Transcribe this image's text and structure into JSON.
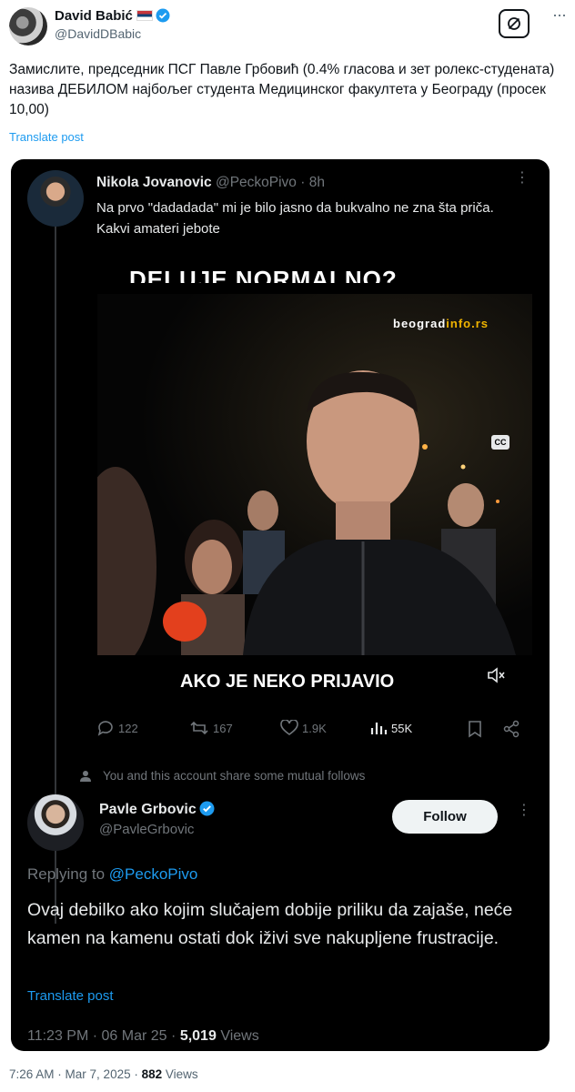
{
  "tweet": {
    "author_name": "David Babić",
    "author_handle": "@DavidDBabic",
    "text": "Замислите, председник ПСГ Павле Грбовић (0.4% гласова и зет ролекс-студената) назива ДЕБИЛОМ најбољег студента Медицинског факултета у Београду (просек 10,00)",
    "translate_label": "Translate post",
    "time": "7:26 AM",
    "date": "Mar 7, 2025",
    "views_count": "882",
    "views_label": "Views"
  },
  "quoted": {
    "author_name": "Nikola Jovanovic",
    "author_handle": "@PeckoPivo",
    "age": "8h",
    "text_line1": "Na prvo \"dadadada\" mi je bilo jasno da bukvalno ne zna šta priča.",
    "text_line2": "Kakvi amateri jebote",
    "video": {
      "caption_top": "DELUJE NORMALNO?",
      "cc_badge": "CC",
      "watermark_main": "beograd",
      "watermark_accent": "info.rs",
      "caption_bottom": "AKO JE NEKO PRIJAVIO"
    },
    "stats": {
      "replies": "122",
      "reposts": "167",
      "likes": "1.9K",
      "views": "55K"
    }
  },
  "mutual_follows_text": "You and this account share some mutual follows",
  "reply": {
    "author_name": "Pavle Grbovic",
    "author_handle": "@PavleGrbovic",
    "follow_label": "Follow",
    "replying_prefix": "Replying to",
    "replying_to": "@PeckoPivo",
    "text": "Ovaj debilko ako kojim slučajem dobije priliku da zajaše, neće kamen na kamenu ostati dok iživi sve nakupljene frustracije.",
    "translate_label": "Translate post",
    "time": "11:23 PM",
    "date": "06 Mar 25",
    "views_count": "5,019",
    "views_label": "Views"
  },
  "colors": {
    "link": "#1d9bf0",
    "verified": "#1d9bf0",
    "card_bg": "#000000",
    "muted": "#71767b"
  }
}
